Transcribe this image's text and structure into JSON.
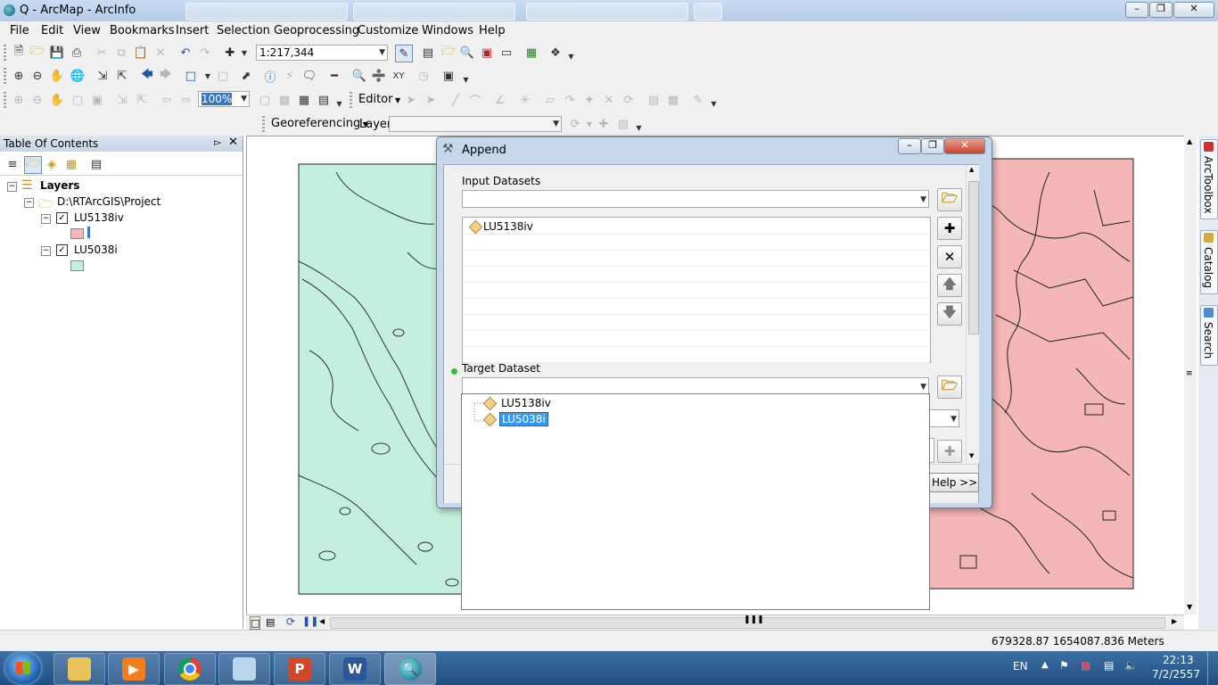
{
  "window": {
    "title": "Q - ArcMap - ArcInfo"
  },
  "menu": [
    "File",
    "Edit",
    "View",
    "Bookmarks",
    "Insert",
    "Selection",
    "Geoprocessing",
    "Customize",
    "Windows",
    "Help"
  ],
  "toolbar": {
    "scale_value": "1:217,344",
    "zoom_percent": "100%",
    "editor_label": "Editor",
    "georeferencing_label": "Georeferencing",
    "layer_label": "Layer:"
  },
  "toc": {
    "title": "Table Of Contents",
    "root": "Layers",
    "folder": "D:\\RTArcGIS\\Project",
    "layers": [
      {
        "name": "LU5138iv",
        "checked": true,
        "symbol_color": "#f4b6b6"
      },
      {
        "name": "LU5038i",
        "checked": true,
        "symbol_color": "#c4eedd"
      }
    ]
  },
  "map": {
    "left_layer_fill": "#c4eedd",
    "right_layer_fill": "#f4b6b6"
  },
  "dialog": {
    "title": "Append",
    "input_label": "Input Datasets",
    "input_list": [
      "LU5138iv"
    ],
    "target_label": "Target Dataset",
    "dropdown_options": [
      "LU5138iv",
      "LU5038i"
    ],
    "selected_option": "LU5038i",
    "help_button": "Help >>"
  },
  "status": {
    "coordinates": "679328.87  1654087.836 Meters"
  },
  "taskbar": {
    "language": "EN",
    "time": "22:13",
    "date": "7/2/2557"
  },
  "dock_tabs": [
    "ArcToolbox",
    "Catalog",
    "Search"
  ]
}
